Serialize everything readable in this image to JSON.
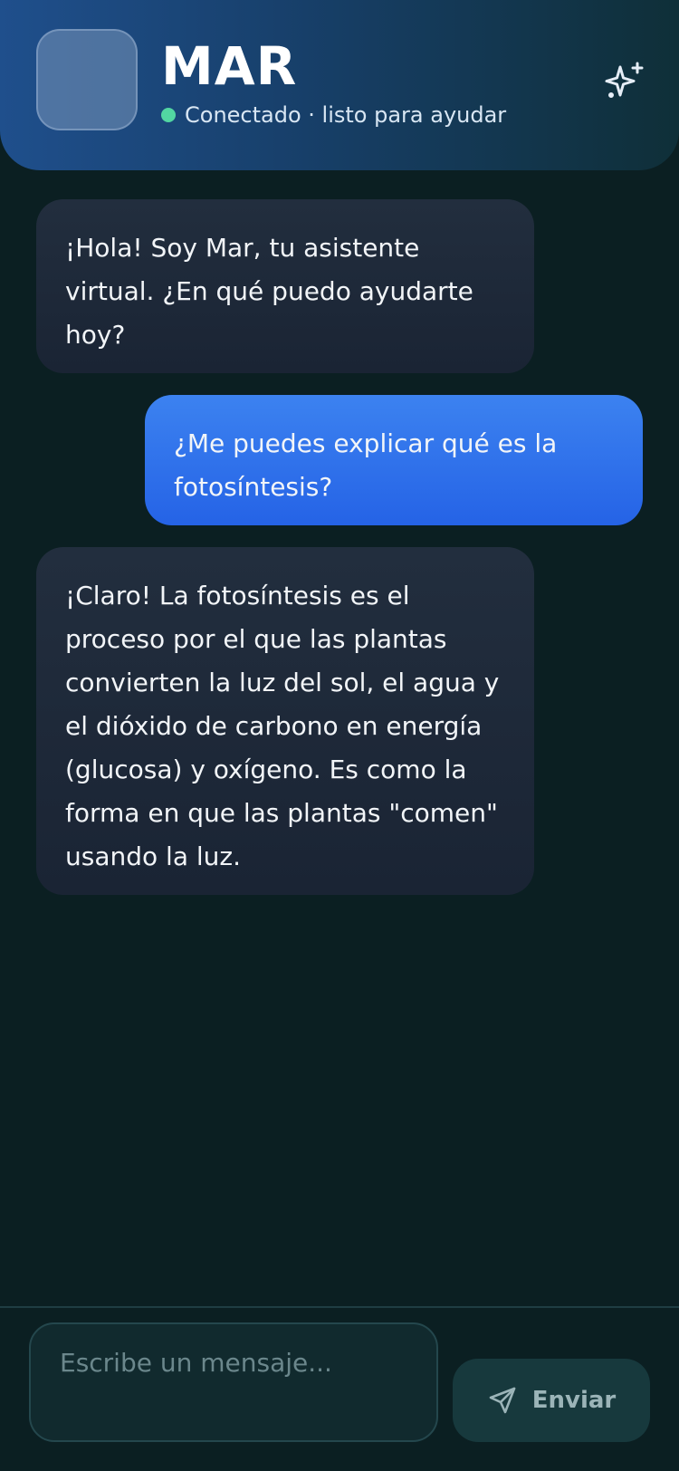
{
  "header": {
    "title": "MAR",
    "status": "Conectado · listo para ayudar",
    "icons": {
      "avatar": "avatar-placeholder",
      "action": "sparkles-icon",
      "status": "online-dot"
    },
    "colors": {
      "status_online": "#52d6a2"
    }
  },
  "messages": [
    {
      "role": "assistant",
      "text": "¡Hola!   Soy Mar, tu asistente virtual. ¿En qué puedo ayudarte hoy?"
    },
    {
      "role": "user",
      "text": "¿Me puedes explicar qué es la fotosíntesis?"
    },
    {
      "role": "assistant",
      "text": "¡Claro!   La fotosíntesis es el proceso por el que las plantas convierten la luz del sol, el agua y el dióxido de carbono en energía (glucosa) y oxígeno. Es como la forma en que las plantas \"comen\" usando la luz."
    }
  ],
  "composer": {
    "placeholder": "Escribe un mensaje...",
    "send_label": "Enviar",
    "send_icon": "send-icon"
  },
  "colors": {
    "user_bubble": "#2f74ee",
    "bot_bubble": "#1e2939",
    "background": "#0b1f22"
  }
}
